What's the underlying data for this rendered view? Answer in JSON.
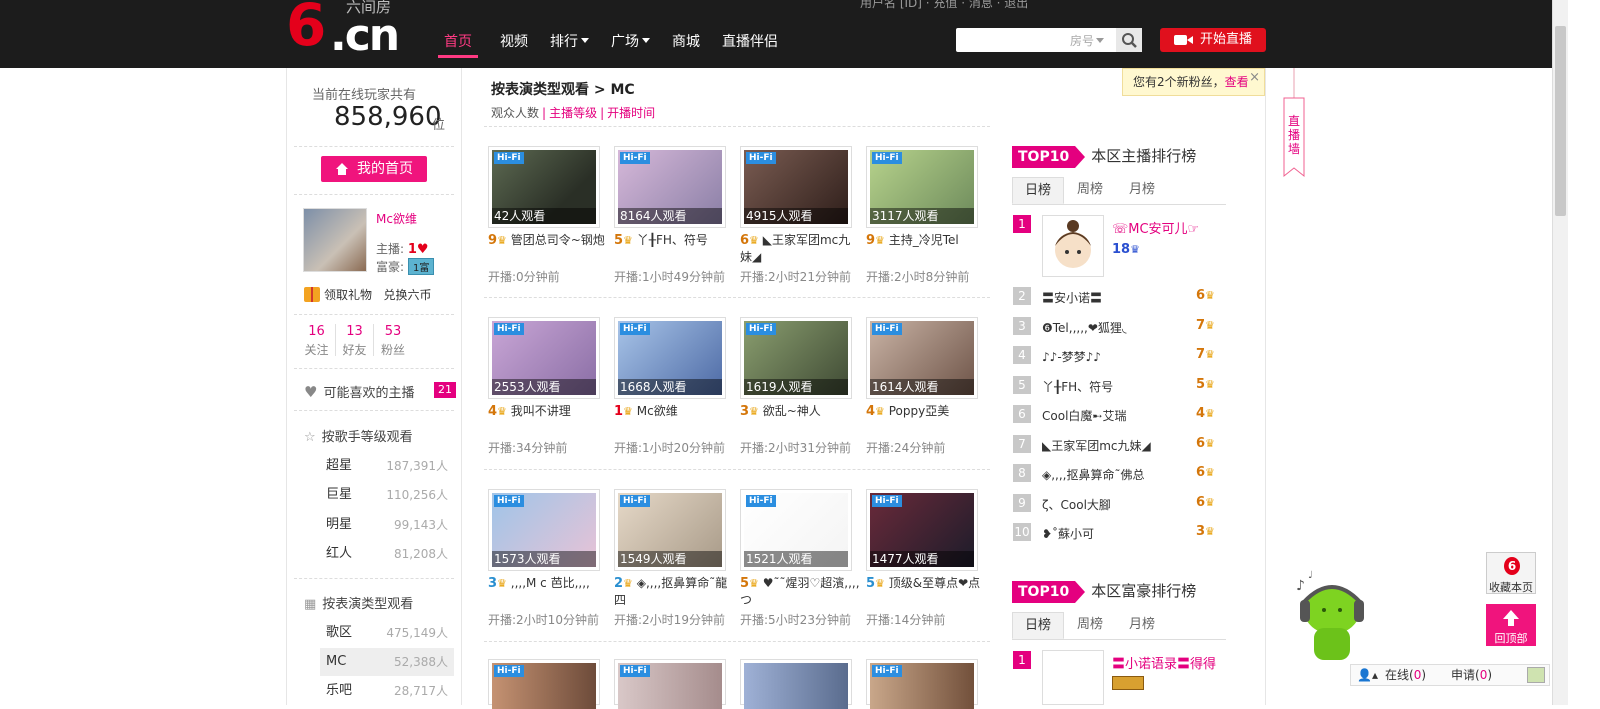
{
  "header": {
    "logo": {
      "six": "6",
      "cn": ".cn",
      "sub": "六间房"
    },
    "top_info": "用户名 [ID] · 充值 · 消息 · 退出",
    "nav": [
      {
        "label": "首页",
        "active": true,
        "caret": false
      },
      {
        "label": "视频",
        "active": false,
        "caret": false
      },
      {
        "label": "排行",
        "active": false,
        "caret": true
      },
      {
        "label": "广场",
        "active": false,
        "caret": true
      },
      {
        "label": "商城",
        "active": false,
        "caret": false
      },
      {
        "label": "直播伴侣",
        "active": false,
        "caret": false
      }
    ],
    "search": {
      "placeholder": "",
      "room_label": "房号"
    },
    "start_live": "开始直播"
  },
  "left": {
    "online_title": "当前在线玩家共有",
    "online_count": "858,960",
    "online_unit": "位",
    "my_home": "我的首页",
    "user": {
      "name": "Mc欲维",
      "host_label": "主播:",
      "host_level": "1",
      "wealth_label": "富豪:",
      "wealth_badge": "1富"
    },
    "gift": "领取礼物",
    "exchange": "兑换六币",
    "stats": [
      {
        "n": "16",
        "l": "关注"
      },
      {
        "n": "13",
        "l": "好友"
      },
      {
        "n": "53",
        "l": "粉丝"
      }
    ],
    "fav_title": "可能喜欢的主播",
    "fav_count": "21",
    "singer_title": "按歌手等级观看",
    "singer_levels": [
      {
        "name": "超星",
        "count": "187,391人"
      },
      {
        "name": "巨星",
        "count": "110,256人"
      },
      {
        "name": "明星",
        "count": "99,143人"
      },
      {
        "name": "红人",
        "count": "81,208人"
      }
    ],
    "type_title": "按表演类型观看",
    "types": [
      {
        "name": "歌区",
        "count": "475,149人",
        "selected": false
      },
      {
        "name": "MC",
        "count": "52,388人",
        "selected": true
      },
      {
        "name": "乐吧",
        "count": "28,717人",
        "selected": false
      }
    ]
  },
  "main": {
    "crumb": "按表演类型观看 > MC",
    "sort": {
      "viewers": "观众人数",
      "level": "主播等级",
      "time": "开播时间"
    },
    "notice": {
      "text": "您有2个新粉丝，",
      "link": "查看",
      "close": "×"
    },
    "cards": [
      {
        "viewers": "42人观看",
        "level": "9",
        "title": "管团总司令~钢炮",
        "time": "开播:0分钟前",
        "color": "o"
      },
      {
        "viewers": "8164人观看",
        "level": "5",
        "title": "丫╂FH、符号",
        "time": "开播:1小时49分钟前",
        "color": "o"
      },
      {
        "viewers": "4915人观看",
        "level": "6",
        "title": "◣王家军团mc九妹◢",
        "time": "开播:2小时21分钟前",
        "color": "o"
      },
      {
        "viewers": "3117人观看",
        "level": "9",
        "title": "主持_冷児Tel",
        "time": "开播:2小时8分钟前",
        "color": "o"
      },
      {
        "viewers": "2553人观看",
        "level": "4",
        "title": "我叫不讲理",
        "time": "开播:34分钟前",
        "color": "o"
      },
      {
        "viewers": "1668人观看",
        "level": "1",
        "title": "Mc欲维",
        "time": "开播:1小时20分钟前",
        "color": "r"
      },
      {
        "viewers": "1619人观看",
        "level": "3",
        "title": "欲乱~神人",
        "time": "开播:2小时31分钟前",
        "color": "o"
      },
      {
        "viewers": "1614人观看",
        "level": "4",
        "title": "Poppy亞美",
        "time": "开播:24分钟前",
        "color": "o"
      },
      {
        "viewers": "1573人观看",
        "level": "3",
        "title": ",,,,M c 芭比,,,,",
        "time": "开播:2小时10分钟前",
        "color": "b"
      },
      {
        "viewers": "1549人观看",
        "level": "2",
        "title": "◈,,,,抠鼻算命˜龍四",
        "time": "开播:2小时19分钟前",
        "color": "b"
      },
      {
        "viewers": "1521人观看",
        "level": "5",
        "title": "♥˜˜煋羽♡超濱,,,,つ",
        "time": "开播:5小时23分钟前",
        "color": "o"
      },
      {
        "viewers": "1477人观看",
        "level": "5",
        "title": "顶级&至尊点❤点",
        "time": "开播:14分钟前",
        "color": "b"
      }
    ]
  },
  "rank": {
    "badge": "TOP10",
    "host_title": "本区主播排行榜",
    "rich_title": "本区富豪排行榜",
    "tabs": [
      "日榜",
      "周榜",
      "月榜"
    ],
    "first": {
      "name": "☏MC安可儿☞",
      "level": "18"
    },
    "items": [
      {
        "n": "2",
        "name": "〓安小诺〓",
        "level": "6"
      },
      {
        "n": "3",
        "name": "❻Tel,,,,,❤狐狸◟",
        "level": "7"
      },
      {
        "n": "4",
        "name": "♪♪-梦梦♪♪",
        "level": "7"
      },
      {
        "n": "5",
        "name": "丫╂FH、符号",
        "level": "5"
      },
      {
        "n": "6",
        "name": "Cool白魔➸艾瑞",
        "level": "4"
      },
      {
        "n": "7",
        "name": "◣王家军团mc九妹◢",
        "level": "6"
      },
      {
        "n": "8",
        "name": "◈,,,,抠鼻算命˜佛总",
        "level": "6"
      },
      {
        "n": "9",
        "name": "ζ、Cool大腳",
        "level": "6"
      },
      {
        "n": "10",
        "name": "❥˚蘇小可",
        "level": "3"
      }
    ],
    "rich_first": {
      "n": "1",
      "name": "〓小诺语录〓得得"
    }
  },
  "side": {
    "vbanner": "直播墙",
    "fav_btn": "收藏本页",
    "top_btn": "回顶部",
    "online": "在线",
    "online_n": "0",
    "apply": "申请",
    "apply_n": "0"
  }
}
